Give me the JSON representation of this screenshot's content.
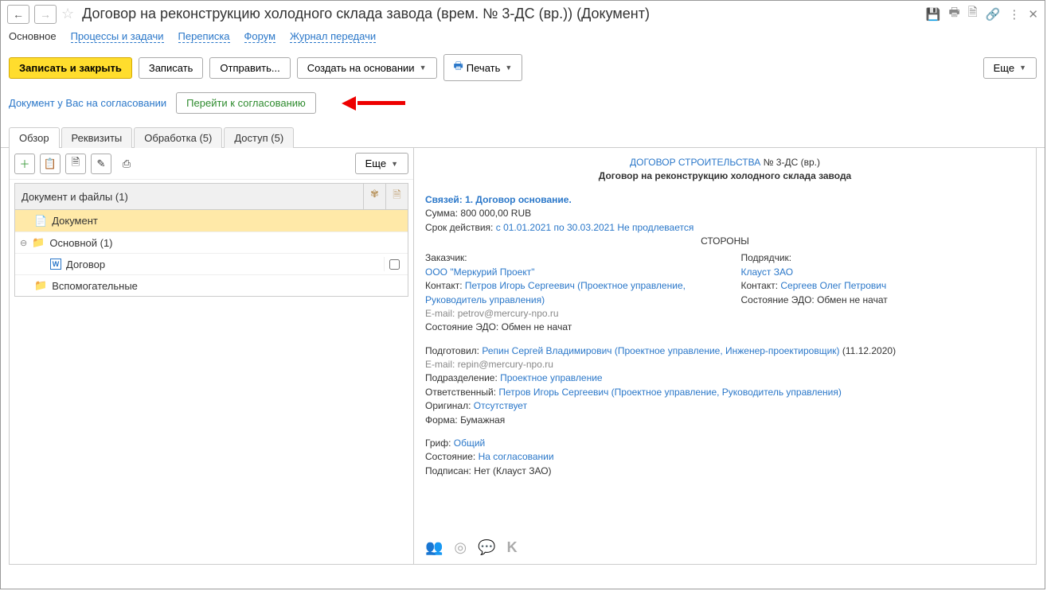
{
  "title": "Договор на реконструкцию холодного склада завода (врем. № 3-ДС (вр.)) (Документ)",
  "menubar": {
    "main": "Основное",
    "processes": "Процессы и задачи",
    "corr": "Переписка",
    "forum": "Форум",
    "journal": "Журнал передачи"
  },
  "toolbar": {
    "save_close": "Записать и закрыть",
    "save": "Записать",
    "send": "Отправить...",
    "create_on": "Создать на основании",
    "print": "Печать",
    "more": "Еще"
  },
  "approval": {
    "msg": "Документ у Вас на согласовании",
    "btn": "Перейти к согласованию"
  },
  "tabs": {
    "overview": "Обзор",
    "details": "Реквизиты",
    "processing": "Обработка (5)",
    "access": "Доступ (5)"
  },
  "left": {
    "more": "Еще",
    "header": "Документ и файлы (1)",
    "tree": {
      "doc": "Документ",
      "main": "Основной (1)",
      "contract": "Договор",
      "aux": "Вспомогательные"
    }
  },
  "right": {
    "doc_type": "ДОГОВОР СТРОИТЕЛЬСТВА",
    "doc_num": "№ 3-ДС (вр.)",
    "doc_title": "Договор на реконструкцию холодного склада завода",
    "links": "Связей: 1. Договор основание.",
    "sum_label": "Сумма:",
    "sum_value": "800 000,00 RUB",
    "period_label": "Срок действия:",
    "period_value": "с 01.01.2021 по 30.03.2021 Не продлевается",
    "parties_header": "СТОРОНЫ",
    "customer": {
      "role": "Заказчик:",
      "name": "ООО \"Меркурий Проект\"",
      "contact_label": "Контакт:",
      "contact_value": "Петров Игорь Сергеевич (Проектное управление, Руководитель управления)",
      "email_label": "E-mail:",
      "email_value": "petrov@mercury-npo.ru",
      "edo_label": "Состояние ЭДО:",
      "edo_value": "Обмен не начат"
    },
    "contractor": {
      "role": "Подрядчик:",
      "name": "Клауст ЗАО",
      "contact_label": "Контакт:",
      "contact_value": "Сергеев Олег Петрович",
      "edo_label": "Состояние ЭДО:",
      "edo_value": "Обмен не начат"
    },
    "prepared_label": "Подготовил:",
    "prepared_value": "Репин Сергей Владимирович (Проектное управление, Инженер-проектировщик)",
    "prepared_date": "(11.12.2020)",
    "email2_label": "E-mail:",
    "email2_value": "repin@mercury-npo.ru",
    "dept_label": "Подразделение:",
    "dept_value": "Проектное управление",
    "resp_label": "Ответственный:",
    "resp_value": "Петров Игорь Сергеевич (Проектное управление, Руководитель управления)",
    "orig_label": "Оригинал:",
    "orig_value": "Отсутствует",
    "form_label": "Форма:",
    "form_value": "Бумажная",
    "stamp_label": "Гриф:",
    "stamp_value": "Общий",
    "state_label": "Состояние:",
    "state_value": "На согласовании",
    "signed_label": "Подписан:",
    "signed_value": "Нет (Клауст ЗАО)"
  }
}
